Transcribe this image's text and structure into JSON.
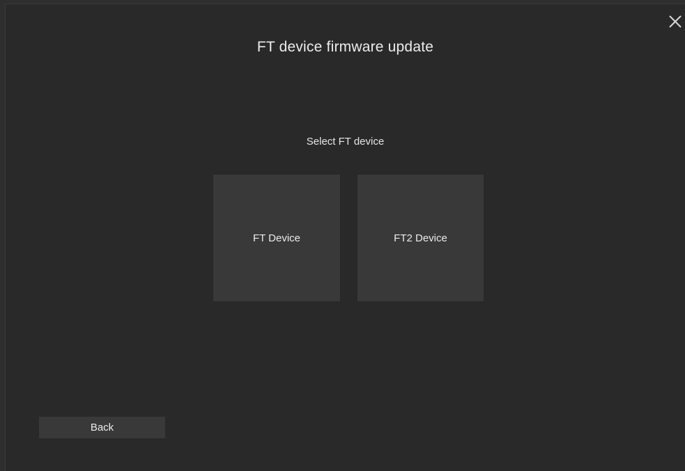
{
  "dialog": {
    "title": "FT device firmware update",
    "subtitle": "Select FT device",
    "close_icon": "close-icon"
  },
  "devices": [
    {
      "label": "FT Device"
    },
    {
      "label": "FT2 Device"
    }
  ],
  "footer": {
    "back_label": "Back"
  },
  "colors": {
    "background": "#292929",
    "tile": "#393939",
    "text": "#e8e8e8"
  }
}
